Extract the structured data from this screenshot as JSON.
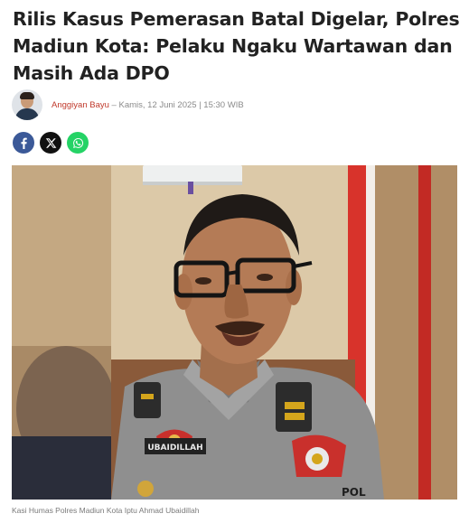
{
  "article": {
    "title": "Rilis Kasus Pemerasan Batal Digelar, Polres Madiun Kota: Pelaku Ngaku Wartawan dan Masih Ada DPO",
    "author": "Anggiyan Bayu",
    "meta": " – Kamis, 12 Juni 2025 | 15:30 WIB",
    "photo_caption": "Kasi Humas Polres Madiun Kota Iptu Ahmad Ubaidillah",
    "photo_alt": "Kasi Humas Polres Madiun Kota Iptu Ahmad Ubaidillah",
    "name_tag": "UBAIDILLAH",
    "shoulder_text": "POL"
  },
  "share": [
    {
      "network": "facebook",
      "icon": "facebook-icon",
      "color": "#3b5998"
    },
    {
      "network": "x",
      "icon": "x-icon",
      "color": "#111111"
    },
    {
      "network": "whatsapp",
      "icon": "whatsapp-icon",
      "color": "#25d366"
    }
  ],
  "colors": {
    "author": "#c0392b",
    "headline": "#222222",
    "meta": "#8a8a8a"
  }
}
